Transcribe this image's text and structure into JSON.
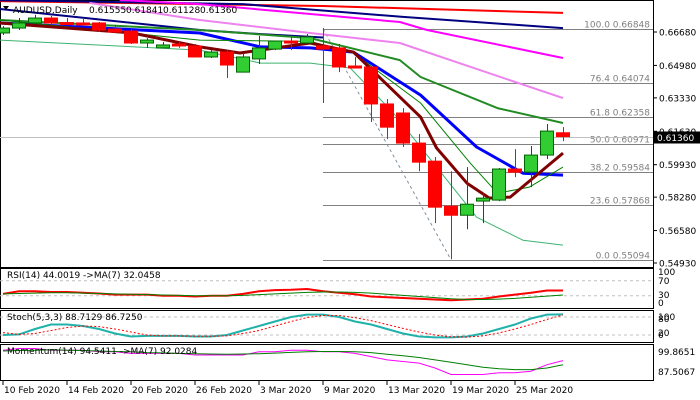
{
  "header": {
    "symbol": "AUDUSD,Daily",
    "open": "0.61555",
    "high": "0.61841",
    "low": "0.61128",
    "close": "0.61360"
  },
  "colors": {
    "bull": "#32CD32",
    "bear": "#FF0000",
    "ma_red": "#FF0000",
    "ma_navy": "#000080",
    "ma_magenta": "#FF00FF",
    "ma_violet": "#EE82EE",
    "ma_green": "#228B22",
    "ma_blue": "#0000FF",
    "ma_darkred": "#800000",
    "band_upper": "#008000",
    "band_lower": "#3CB371",
    "stoch_main": "#20B2AA"
  },
  "chart_data": [
    {
      "type": "candlestick",
      "title": "AUDUSD,Daily",
      "ylim": [
        0.5493,
        0.6835
      ],
      "price_ticks": [
        "0.66680",
        "0.64980",
        "0.63330",
        "0.61630",
        "0.59930",
        "0.58280",
        "0.56580",
        "0.54930"
      ],
      "current_price": "0.61360",
      "x_labels": [
        {
          "bar": 0,
          "label": "10 Feb 2020"
        },
        {
          "bar": 4,
          "label": "14 Feb 2020"
        },
        {
          "bar": 8,
          "label": "20 Feb 2020"
        },
        {
          "bar": 12,
          "label": "26 Feb 2020"
        },
        {
          "bar": 16,
          "label": "3 Mar 2020"
        },
        {
          "bar": 20,
          "label": "9 Mar 2020"
        },
        {
          "bar": 24,
          "label": "13 Mar 2020"
        },
        {
          "bar": 28,
          "label": "19 Mar 2020"
        },
        {
          "bar": 32,
          "label": "25 Mar 2020"
        }
      ],
      "ohlc": [
        [
          0.6663,
          0.6698,
          0.6653,
          0.6688
        ],
        [
          0.6688,
          0.6739,
          0.6678,
          0.6714
        ],
        [
          0.6714,
          0.6755,
          0.6714,
          0.6739
        ],
        [
          0.6739,
          0.675,
          0.6704,
          0.6714
        ],
        [
          0.6716,
          0.6739,
          0.6704,
          0.6712
        ],
        [
          0.6714,
          0.6739,
          0.6709,
          0.6712
        ],
        [
          0.6714,
          0.6719,
          0.6668,
          0.6678
        ],
        [
          0.6683,
          0.6704,
          0.6663,
          0.6668
        ],
        [
          0.6673,
          0.6683,
          0.6607,
          0.6612
        ],
        [
          0.6612,
          0.6637,
          0.6587,
          0.6627
        ],
        [
          0.6587,
          0.6617,
          0.6587,
          0.6602
        ],
        [
          0.6607,
          0.6617,
          0.6587,
          0.66
        ],
        [
          0.6597,
          0.6607,
          0.6541,
          0.6541
        ],
        [
          0.6541,
          0.6576,
          0.6536,
          0.6566
        ],
        [
          0.6566,
          0.6576,
          0.6434,
          0.65
        ],
        [
          0.6464,
          0.6561,
          0.6464,
          0.6541
        ],
        [
          0.6531,
          0.6648,
          0.6505,
          0.6587
        ],
        [
          0.6581,
          0.6622,
          0.6576,
          0.6622
        ],
        [
          0.6622,
          0.6643,
          0.6576,
          0.6612
        ],
        [
          0.6612,
          0.6658,
          0.6602,
          0.6643
        ],
        [
          0.6597,
          0.6688,
          0.6307,
          0.6581
        ],
        [
          0.6587,
          0.6607,
          0.6464,
          0.649
        ],
        [
          0.6495,
          0.6541,
          0.649,
          0.649
        ],
        [
          0.649,
          0.649,
          0.621,
          0.6302
        ],
        [
          0.6302,
          0.6327,
          0.6123,
          0.6184
        ],
        [
          0.6256,
          0.6281,
          0.6083,
          0.6103
        ],
        [
          0.6103,
          0.6149,
          0.596,
          0.6006
        ],
        [
          0.6011,
          0.6032,
          0.5696,
          0.5777
        ],
        [
          0.5782,
          0.596,
          0.5512,
          0.5736
        ],
        [
          0.5736,
          0.5981,
          0.5665,
          0.5792
        ],
        [
          0.5808,
          0.5848,
          0.5696,
          0.5823
        ],
        [
          0.5813,
          0.5976,
          0.5808,
          0.5971
        ],
        [
          0.5971,
          0.6072,
          0.593,
          0.5955
        ],
        [
          0.5955,
          0.6088,
          0.5879,
          0.6042
        ],
        [
          0.6042,
          0.62,
          0.6022,
          0.6164
        ],
        [
          0.61555,
          0.61841,
          0.61128,
          0.6136
        ]
      ],
      "moving_averages": [
        {
          "name": "ma-red",
          "color": "#FF0000",
          "width": 2,
          "points": [
            [
              -0.2,
              0.6825
            ],
            [
              20,
              0.68
            ],
            [
              35,
              0.6765
            ]
          ]
        },
        {
          "name": "ma-navy-upper",
          "color": "#000080",
          "width": 2,
          "points": [
            [
              -0.2,
              0.683
            ],
            [
              15,
              0.681
            ],
            [
              25,
              0.6745
            ],
            [
              35,
              0.6688
            ]
          ]
        },
        {
          "name": "ma-navy-lower",
          "color": "#000080",
          "width": 2,
          "points": [
            [
              -0.2,
              0.6785
            ],
            [
              12.3,
              0.6678
            ],
            [
              16,
              0.6658
            ],
            [
              20,
              0.664
            ]
          ]
        },
        {
          "name": "ma-magenta",
          "color": "#FF00FF",
          "width": 2,
          "points": [
            [
              7.3,
              0.6831
            ],
            [
              12.3,
              0.681
            ],
            [
              24.8,
              0.6719
            ],
            [
              26.5,
              0.6678
            ],
            [
              35,
              0.6536
            ]
          ]
        },
        {
          "name": "ma-violet",
          "color": "#EE82EE",
          "width": 2,
          "points": [
            [
              5.4,
              0.6816
            ],
            [
              12.3,
              0.6729
            ],
            [
              19.2,
              0.6663
            ],
            [
              24.8,
              0.6612
            ],
            [
              35,
              0.6332
            ]
          ]
        },
        {
          "name": "ma-green",
          "color": "#228B22",
          "width": 2,
          "points": [
            [
              -0.2,
              0.6729
            ],
            [
              12.3,
              0.6678
            ],
            [
              19.2,
              0.6637
            ],
            [
              24.8,
              0.6525
            ],
            [
              26.1,
              0.6439
            ],
            [
              30.9,
              0.6281
            ],
            [
              35,
              0.6205
            ]
          ]
        },
        {
          "name": "ma-blue",
          "color": "#0000FF",
          "width": 3,
          "points": [
            [
              -0.2,
              0.6714
            ],
            [
              12.3,
              0.6663
            ],
            [
              16.1,
              0.6592
            ],
            [
              19.2,
              0.6587
            ],
            [
              21.9,
              0.6566
            ],
            [
              26.1,
              0.6347
            ],
            [
              29.6,
              0.6083
            ],
            [
              32.5,
              0.595
            ],
            [
              35,
              0.594
            ]
          ]
        },
        {
          "name": "band-upper",
          "color": "#008000",
          "width": 1,
          "points": [
            [
              -0.2,
              0.6729
            ],
            [
              12.3,
              0.6627
            ],
            [
              19.2,
              0.662
            ],
            [
              21.9,
              0.6561
            ],
            [
              26.1,
              0.6307
            ],
            [
              29.2,
              0.6001
            ],
            [
              30.9,
              0.5848
            ],
            [
              32.9,
              0.5879
            ],
            [
              35,
              0.5981
            ]
          ]
        },
        {
          "name": "band-lower",
          "color": "#3CB371",
          "width": 1,
          "points": [
            [
              -0.2,
              0.6627
            ],
            [
              12.3,
              0.6576
            ],
            [
              16.1,
              0.651
            ],
            [
              19.2,
              0.651
            ],
            [
              21.7,
              0.6485
            ],
            [
              24.4,
              0.6256
            ],
            [
              27.1,
              0.5981
            ],
            [
              29.6,
              0.5726
            ],
            [
              32.5,
              0.5609
            ],
            [
              35,
              0.5584
            ]
          ]
        },
        {
          "name": "ma-darkred",
          "color": "#800000",
          "width": 3,
          "points": [
            [
              -0.2,
              0.6714
            ],
            [
              8.1,
              0.6663
            ],
            [
              12.3,
              0.6592
            ],
            [
              14.8,
              0.6561
            ],
            [
              19.2,
              0.6612
            ],
            [
              21.9,
              0.6566
            ],
            [
              26.1,
              0.6235
            ],
            [
              27.1,
              0.6078
            ],
            [
              29,
              0.5899
            ],
            [
              30.4,
              0.5823
            ],
            [
              31.7,
              0.5828
            ],
            [
              35,
              0.6052
            ]
          ]
        }
      ],
      "fibonacci": {
        "start_bar": 20,
        "trend": [
          [
            20,
            0.66848
          ],
          [
            28,
            0.55094
          ]
        ],
        "levels": [
          {
            "label": "100.0 0.66848",
            "price": 0.66848
          },
          {
            "label": "76.4 0.64074",
            "price": 0.64074
          },
          {
            "label": "61.8 0.62358",
            "price": 0.62358
          },
          {
            "label": "50.0 0.60971",
            "price": 0.60971
          },
          {
            "label": "38.2 0.59584",
            "price": 0.59584
          },
          {
            "label": "23.6 0.57868",
            "price": 0.57868
          },
          {
            "label": "0.0 0.55094",
            "price": 0.55094
          }
        ]
      }
    },
    {
      "type": "line",
      "title": "RSI(14) 44.0019  ->MA(7) 32.0458",
      "ylim": [
        0,
        100
      ],
      "levels": [
        70,
        30
      ],
      "tick_labels": [
        "100",
        "70",
        "30",
        "0"
      ],
      "series": [
        {
          "name": "RSI(14)",
          "color": "#FF0000",
          "values": [
            35,
            42,
            42,
            40,
            40,
            38,
            36,
            33,
            33,
            33,
            30,
            30,
            28,
            30,
            30,
            35,
            42,
            45,
            46,
            48,
            42,
            38,
            34,
            28,
            26,
            24,
            22,
            20,
            18,
            20,
            22,
            28,
            33,
            38,
            44,
            44.0019
          ]
        },
        {
          "name": "MA(7)",
          "color": "#008000",
          "values": [
            35,
            36,
            37,
            38,
            38,
            37,
            36,
            35,
            34,
            33,
            32,
            31,
            30,
            30,
            30,
            31,
            33,
            35,
            37,
            39,
            40,
            40,
            39,
            37,
            34,
            31,
            28,
            25,
            22,
            20,
            20,
            21,
            23,
            26,
            29,
            32.0458
          ]
        }
      ]
    },
    {
      "type": "line",
      "title": "Stoch(5,3,3) 88.7129 86.7250",
      "ylim": [
        0,
        100
      ],
      "levels": [
        80,
        20
      ],
      "tick_labels": [
        "100",
        "80",
        "20",
        "0"
      ],
      "series": [
        {
          "name": "Main",
          "color": "#20B2AA",
          "values": [
            20,
            22,
            40,
            55,
            55,
            50,
            40,
            25,
            15,
            17,
            17,
            17,
            15,
            15,
            20,
            35,
            50,
            65,
            80,
            88,
            88,
            80,
            65,
            55,
            40,
            25,
            15,
            12,
            12,
            15,
            25,
            40,
            55,
            75,
            88,
            88.7129
          ]
        },
        {
          "name": "Signal",
          "color": "#FF0000",
          "values": [
            28,
            22,
            25,
            35,
            45,
            50,
            48,
            40,
            30,
            20,
            17,
            17,
            16,
            16,
            17,
            25,
            35,
            50,
            65,
            78,
            85,
            85,
            78,
            68,
            55,
            42,
            30,
            20,
            14,
            13,
            17,
            27,
            40,
            55,
            72,
            86.725
          ]
        }
      ]
    },
    {
      "type": "line",
      "title": "Momentum(14) 94.5411  ->MA(7) 92.0284",
      "ylim": [
        82.6,
        104.8
      ],
      "tick_labels": [
        "99.8651",
        "87.5067"
      ],
      "series": [
        {
          "name": "Momentum(14)",
          "color": "#FF00FF",
          "values": [
            101,
            102,
            102,
            101,
            101,
            101,
            100,
            100,
            99,
            99,
            99,
            99,
            98,
            98,
            98,
            98,
            100,
            100,
            101,
            101,
            100,
            100,
            99,
            97,
            95,
            94,
            93,
            90,
            86,
            86,
            86,
            87,
            87,
            88,
            92,
            94.5411
          ]
        },
        {
          "name": "MA(7)",
          "color": "#008000",
          "values": [
            100.5,
            100.8,
            101,
            101.2,
            101,
            100.8,
            100.5,
            100.2,
            100,
            99.5,
            99.3,
            99,
            98.8,
            98.6,
            98.5,
            98.6,
            98.8,
            99.2,
            99.6,
            100,
            100.2,
            100.2,
            100,
            99.5,
            98.5,
            97.5,
            96.5,
            95,
            93.5,
            92,
            90.5,
            89.5,
            89,
            89,
            90,
            92.0284
          ]
        }
      ]
    }
  ]
}
